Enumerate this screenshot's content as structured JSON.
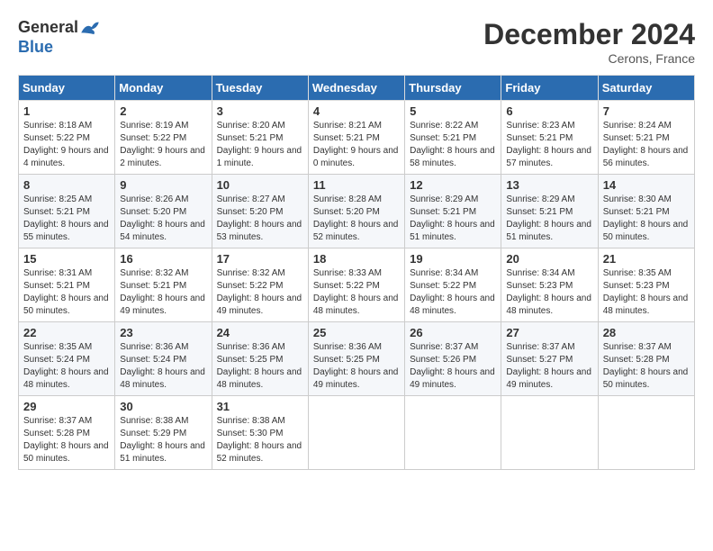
{
  "header": {
    "logo_line1": "General",
    "logo_line2": "Blue",
    "month": "December 2024",
    "location": "Cerons, France"
  },
  "weekdays": [
    "Sunday",
    "Monday",
    "Tuesday",
    "Wednesday",
    "Thursday",
    "Friday",
    "Saturday"
  ],
  "weeks": [
    [
      {
        "day": 1,
        "sunrise": "8:18 AM",
        "sunset": "5:22 PM",
        "daylight": "9 hours and 4 minutes."
      },
      {
        "day": 2,
        "sunrise": "8:19 AM",
        "sunset": "5:22 PM",
        "daylight": "9 hours and 2 minutes."
      },
      {
        "day": 3,
        "sunrise": "8:20 AM",
        "sunset": "5:21 PM",
        "daylight": "9 hours and 1 minute."
      },
      {
        "day": 4,
        "sunrise": "8:21 AM",
        "sunset": "5:21 PM",
        "daylight": "9 hours and 0 minutes."
      },
      {
        "day": 5,
        "sunrise": "8:22 AM",
        "sunset": "5:21 PM",
        "daylight": "8 hours and 58 minutes."
      },
      {
        "day": 6,
        "sunrise": "8:23 AM",
        "sunset": "5:21 PM",
        "daylight": "8 hours and 57 minutes."
      },
      {
        "day": 7,
        "sunrise": "8:24 AM",
        "sunset": "5:21 PM",
        "daylight": "8 hours and 56 minutes."
      }
    ],
    [
      {
        "day": 8,
        "sunrise": "8:25 AM",
        "sunset": "5:21 PM",
        "daylight": "8 hours and 55 minutes."
      },
      {
        "day": 9,
        "sunrise": "8:26 AM",
        "sunset": "5:20 PM",
        "daylight": "8 hours and 54 minutes."
      },
      {
        "day": 10,
        "sunrise": "8:27 AM",
        "sunset": "5:20 PM",
        "daylight": "8 hours and 53 minutes."
      },
      {
        "day": 11,
        "sunrise": "8:28 AM",
        "sunset": "5:20 PM",
        "daylight": "8 hours and 52 minutes."
      },
      {
        "day": 12,
        "sunrise": "8:29 AM",
        "sunset": "5:21 PM",
        "daylight": "8 hours and 51 minutes."
      },
      {
        "day": 13,
        "sunrise": "8:29 AM",
        "sunset": "5:21 PM",
        "daylight": "8 hours and 51 minutes."
      },
      {
        "day": 14,
        "sunrise": "8:30 AM",
        "sunset": "5:21 PM",
        "daylight": "8 hours and 50 minutes."
      }
    ],
    [
      {
        "day": 15,
        "sunrise": "8:31 AM",
        "sunset": "5:21 PM",
        "daylight": "8 hours and 50 minutes."
      },
      {
        "day": 16,
        "sunrise": "8:32 AM",
        "sunset": "5:21 PM",
        "daylight": "8 hours and 49 minutes."
      },
      {
        "day": 17,
        "sunrise": "8:32 AM",
        "sunset": "5:22 PM",
        "daylight": "8 hours and 49 minutes."
      },
      {
        "day": 18,
        "sunrise": "8:33 AM",
        "sunset": "5:22 PM",
        "daylight": "8 hours and 48 minutes."
      },
      {
        "day": 19,
        "sunrise": "8:34 AM",
        "sunset": "5:22 PM",
        "daylight": "8 hours and 48 minutes."
      },
      {
        "day": 20,
        "sunrise": "8:34 AM",
        "sunset": "5:23 PM",
        "daylight": "8 hours and 48 minutes."
      },
      {
        "day": 21,
        "sunrise": "8:35 AM",
        "sunset": "5:23 PM",
        "daylight": "8 hours and 48 minutes."
      }
    ],
    [
      {
        "day": 22,
        "sunrise": "8:35 AM",
        "sunset": "5:24 PM",
        "daylight": "8 hours and 48 minutes."
      },
      {
        "day": 23,
        "sunrise": "8:36 AM",
        "sunset": "5:24 PM",
        "daylight": "8 hours and 48 minutes."
      },
      {
        "day": 24,
        "sunrise": "8:36 AM",
        "sunset": "5:25 PM",
        "daylight": "8 hours and 48 minutes."
      },
      {
        "day": 25,
        "sunrise": "8:36 AM",
        "sunset": "5:25 PM",
        "daylight": "8 hours and 49 minutes."
      },
      {
        "day": 26,
        "sunrise": "8:37 AM",
        "sunset": "5:26 PM",
        "daylight": "8 hours and 49 minutes."
      },
      {
        "day": 27,
        "sunrise": "8:37 AM",
        "sunset": "5:27 PM",
        "daylight": "8 hours and 49 minutes."
      },
      {
        "day": 28,
        "sunrise": "8:37 AM",
        "sunset": "5:28 PM",
        "daylight": "8 hours and 50 minutes."
      }
    ],
    [
      {
        "day": 29,
        "sunrise": "8:37 AM",
        "sunset": "5:28 PM",
        "daylight": "8 hours and 50 minutes."
      },
      {
        "day": 30,
        "sunrise": "8:38 AM",
        "sunset": "5:29 PM",
        "daylight": "8 hours and 51 minutes."
      },
      {
        "day": 31,
        "sunrise": "8:38 AM",
        "sunset": "5:30 PM",
        "daylight": "8 hours and 52 minutes."
      },
      null,
      null,
      null,
      null
    ]
  ],
  "labels": {
    "sunrise": "Sunrise:",
    "sunset": "Sunset:",
    "daylight": "Daylight:"
  }
}
